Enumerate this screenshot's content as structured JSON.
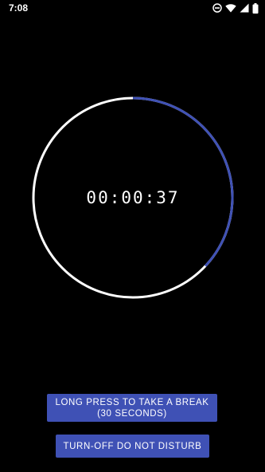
{
  "status_bar": {
    "time": "7:08",
    "icons": [
      "do-not-disturb-icon",
      "wifi-icon",
      "cellular-signal-icon",
      "battery-icon"
    ]
  },
  "timer": {
    "display": "00:00:37",
    "progress_fraction": 0.37,
    "ring_color": "#ffffff",
    "progress_color": "#3f51b5"
  },
  "buttons": {
    "break_label": "LONG PRESS TO TAKE A BREAK\n(30 SECONDS)",
    "dnd_label": "TURN-OFF DO NOT DISTURB",
    "color": "#3f51b5"
  }
}
